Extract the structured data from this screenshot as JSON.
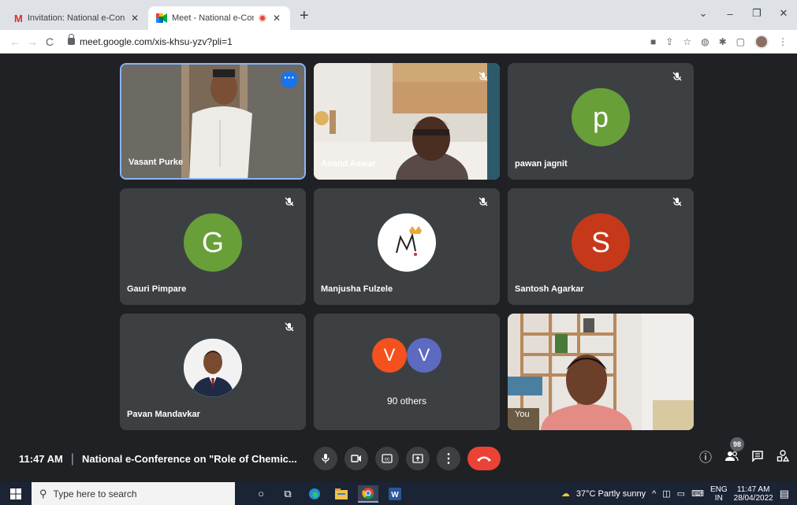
{
  "browser": {
    "tabs": [
      {
        "title": "Invitation: National e-Conference",
        "icon": "gmail-icon",
        "close": "✕"
      },
      {
        "title": "Meet - National e-Conferenc",
        "icon": "meet-icon",
        "close": "✕"
      }
    ],
    "new_tab": "+",
    "url": "meet.google.com/xis-khsu-yzv?pli=1"
  },
  "meeting": {
    "participants": [
      {
        "name": "Vasant Purke",
        "type": "video",
        "active_speaker": true
      },
      {
        "name": "Anand Aswar",
        "type": "video",
        "muted": true
      },
      {
        "name": "pawan jagnit",
        "type": "initial",
        "initial": "p",
        "color": "#689f38",
        "muted": true
      },
      {
        "name": "Gauri Pimpare",
        "type": "initial",
        "initial": "G",
        "color": "#689f38",
        "muted": true
      },
      {
        "name": "Manjusha Fulzele",
        "type": "logo",
        "muted": true
      },
      {
        "name": "Santosh Agarkar",
        "type": "initial",
        "initial": "S",
        "color": "#c5391a",
        "muted": true
      },
      {
        "name": "Pavan Mandavkar",
        "type": "photo",
        "muted": true
      },
      {
        "name": "90 others",
        "type": "group",
        "initials": [
          "V",
          "V"
        ],
        "colors": [
          "#f4511e",
          "#5c6bc0"
        ]
      },
      {
        "name": "You",
        "type": "video"
      }
    ],
    "time": "11:47 AM",
    "separator": "|",
    "title": "National e-Conference on \"Role of Chemic...",
    "participant_count": "98"
  },
  "taskbar": {
    "search_placeholder": "Type here to search",
    "weather": "37°C  Partly sunny",
    "lang_top": "ENG",
    "lang_bottom": "IN",
    "time": "11:47 AM",
    "date": "28/04/2022"
  }
}
